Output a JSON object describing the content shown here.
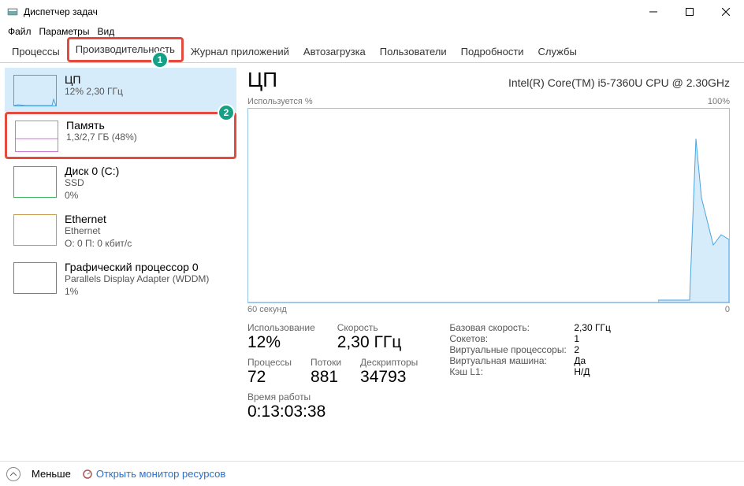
{
  "window": {
    "title": "Диспетчер задач"
  },
  "menu": {
    "file": "Файл",
    "options": "Параметры",
    "view": "Вид"
  },
  "tabs": {
    "processes": "Процессы",
    "performance": "Производительность",
    "app_history": "Журнал приложений",
    "startup": "Автозагрузка",
    "users": "Пользователи",
    "details": "Подробности",
    "services": "Службы"
  },
  "sidebar": {
    "cpu": {
      "title": "ЦП",
      "sub": "12%  2,30 ГГц"
    },
    "memory": {
      "title": "Память",
      "sub": "1,3/2,7 ГБ (48%)"
    },
    "disk": {
      "title": "Диск 0 (C:)",
      "sub1": "SSD",
      "sub2": "0%"
    },
    "ethernet": {
      "title": "Ethernet",
      "sub1": "Ethernet",
      "sub2": "О: 0  П: 0 кбит/с"
    },
    "gpu": {
      "title": "Графический процессор 0",
      "sub1": "Parallels Display Adapter (WDDM)",
      "sub2": "1%"
    }
  },
  "main": {
    "heading": "ЦП",
    "cpu_model": "Intel(R) Core(TM) i5-7360U CPU @ 2.30GHz",
    "chart_top_left": "Используется %",
    "chart_top_right": "100%",
    "chart_bottom_left": "60 секунд",
    "chart_bottom_right": "0",
    "stats": {
      "usage_label": "Использование",
      "usage_value": "12%",
      "speed_label": "Скорость",
      "speed_value": "2,30 ГГц",
      "processes_label": "Процессы",
      "processes_value": "72",
      "threads_label": "Потоки",
      "threads_value": "881",
      "handles_label": "Дескрипторы",
      "handles_value": "34793",
      "uptime_label": "Время работы",
      "uptime_value": "0:13:03:38"
    },
    "kv": {
      "base_speed_k": "Базовая скорость:",
      "base_speed_v": "2,30 ГГц",
      "sockets_k": "Сокетов:",
      "sockets_v": "1",
      "vproc_k": "Виртуальные процессоры:",
      "vproc_v": "2",
      "vm_k": "Виртуальная машина:",
      "vm_v": "Да",
      "l1_k": "Кэш L1:",
      "l1_v": "Н/Д"
    }
  },
  "footer": {
    "fewer": "Меньше",
    "open_monitor": "Открыть монитор ресурсов"
  },
  "badges": {
    "b1": "1",
    "b2": "2"
  },
  "chart_data": {
    "type": "line",
    "title": "ЦП — Используется %",
    "xlabel": "секунд",
    "ylabel": "%",
    "ylim": [
      0,
      100
    ],
    "x_range_label": "60 секунд",
    "x": [
      0,
      5,
      10,
      15,
      20,
      25,
      30,
      35,
      40,
      45,
      50,
      52,
      53,
      54,
      56,
      58,
      60
    ],
    "values": [
      2,
      2,
      2,
      2,
      2,
      2,
      2,
      2,
      2,
      2,
      2,
      2,
      85,
      60,
      30,
      35,
      32
    ]
  }
}
